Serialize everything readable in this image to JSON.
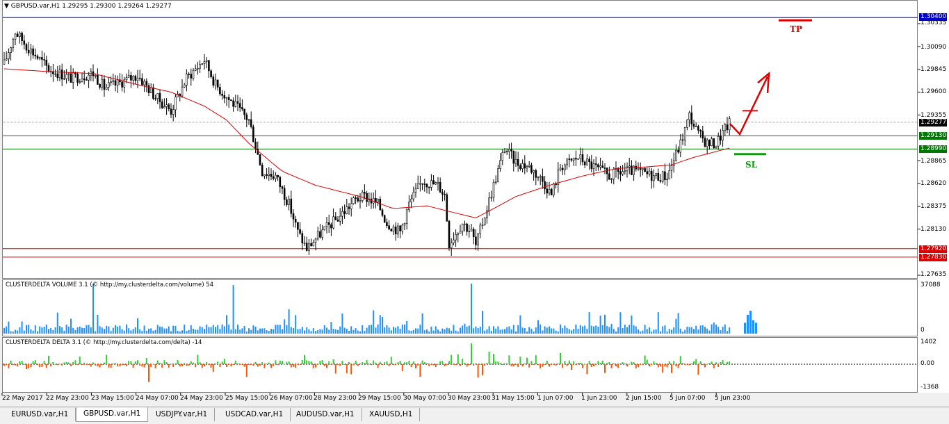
{
  "main": {
    "title": "GBPUSD.var,H1  1.29295 1.29300 1.29264 1.29277",
    "y_labels": [
      "1.30335",
      "1.30090",
      "1.29845",
      "1.29600",
      "1.29355",
      "1.28865",
      "1.28620",
      "1.28375",
      "1.28130",
      "1.27635"
    ],
    "levels": [
      {
        "value": "1.30400",
        "color": "#0000cc"
      },
      {
        "value": "1.29277",
        "color": "#000000"
      },
      {
        "value": "1.29130",
        "color": "#007700"
      },
      {
        "value": "1.28990",
        "color": "#007700"
      },
      {
        "value": "1.27920",
        "color": "#dd0000"
      },
      {
        "value": "1.27830",
        "color": "#dd0000"
      }
    ],
    "tp_label": "TP",
    "sl_label": "SL"
  },
  "volume": {
    "title": "CLUSTERDELTA VOLUME 3.1 (© http://my.clusterdelta.com/volume) 54",
    "max_label": "37088",
    "min_label": "0",
    "color": "#1e90ff"
  },
  "delta": {
    "title": "CLUSTERDELTA DELTA 3.1 (© http://my.clusterdelta.com/delta) -14",
    "max_label": "1402",
    "zero_label": "0.00",
    "min_label": "-1368",
    "pos_color": "#33cc33",
    "neg_color": "#ff5500"
  },
  "x_labels": [
    "22 May 2017",
    "22 May 23:00",
    "23 May 15:00",
    "24 May 07:00",
    "24 May 23:00",
    "25 May 15:00",
    "26 May 07:00",
    "28 May 23:00",
    "29 May 15:00",
    "30 May 07:00",
    "30 May 23:00",
    "31 May 15:00",
    "1 Jun 07:00",
    "1 Jun 23:00",
    "2 Jun 15:00",
    "5 Jun 07:00",
    "5 Jun 23:00"
  ],
  "tabs": [
    "EURUSD.var,H1",
    "GBPUSD.var,H1",
    "USDJPY.var,H1",
    "USDCAD.var,H1",
    "AUDUSD.var,H1",
    "XAUUSD,H1"
  ],
  "active_tab": "GBPUSD.var,H1",
  "chart_data": {
    "type": "candlestick",
    "symbol": "GBPUSD.var",
    "timeframe": "H1",
    "ylim": [
      1.2755,
      1.3046
    ],
    "sma_color": "#dd0000",
    "close_path": [
      [
        0,
        1.299
      ],
      [
        5,
        1.3025
      ],
      [
        10,
        1.301
      ],
      [
        20,
        1.2985
      ],
      [
        30,
        1.2975
      ],
      [
        40,
        1.298
      ],
      [
        45,
        1.2965
      ],
      [
        50,
        1.2968
      ],
      [
        60,
        1.2978
      ],
      [
        68,
        1.2955
      ],
      [
        75,
        1.294
      ],
      [
        82,
        1.2975
      ],
      [
        90,
        1.2995
      ],
      [
        95,
        1.2968
      ],
      [
        100,
        1.2955
      ],
      [
        110,
        1.293
      ],
      [
        116,
        1.2875
      ],
      [
        122,
        1.287
      ],
      [
        128,
        1.284
      ],
      [
        132,
        1.281
      ],
      [
        136,
        1.2792
      ],
      [
        142,
        1.2808
      ],
      [
        150,
        1.2825
      ],
      [
        158,
        1.2845
      ],
      [
        162,
        1.2848
      ],
      [
        168,
        1.284
      ],
      [
        172,
        1.282
      ],
      [
        178,
        1.281
      ],
      [
        182,
        1.284
      ],
      [
        188,
        1.2865
      ],
      [
        195,
        1.286
      ],
      [
        198,
        1.285
      ],
      [
        200,
        1.2798
      ],
      [
        206,
        1.282
      ],
      [
        210,
        1.281
      ],
      [
        212,
        1.2795
      ],
      [
        215,
        1.282
      ],
      [
        220,
        1.286
      ],
      [
        225,
        1.29
      ],
      [
        230,
        1.2885
      ],
      [
        236,
        1.288
      ],
      [
        242,
        1.2865
      ],
      [
        246,
        1.285
      ],
      [
        250,
        1.288
      ],
      [
        258,
        1.289
      ],
      [
        265,
        1.288
      ],
      [
        272,
        1.287
      ],
      [
        278,
        1.2875
      ],
      [
        284,
        1.2875
      ],
      [
        292,
        1.287
      ],
      [
        298,
        1.287
      ],
      [
        304,
        1.2905
      ],
      [
        308,
        1.2935
      ],
      [
        312,
        1.2915
      ],
      [
        316,
        1.2905
      ],
      [
        320,
        1.2905
      ],
      [
        324,
        1.292
      ],
      [
        326,
        1.2927
      ]
    ],
    "sma_path": [
      [
        0,
        1.2985
      ],
      [
        20,
        1.2982
      ],
      [
        40,
        1.298
      ],
      [
        60,
        1.2968
      ],
      [
        75,
        1.296
      ],
      [
        90,
        1.2945
      ],
      [
        100,
        1.293
      ],
      [
        110,
        1.2905
      ],
      [
        125,
        1.2875
      ],
      [
        140,
        1.286
      ],
      [
        160,
        1.2848
      ],
      [
        175,
        1.2835
      ],
      [
        190,
        1.2838
      ],
      [
        200,
        1.2832
      ],
      [
        212,
        1.2825
      ],
      [
        220,
        1.2835
      ],
      [
        230,
        1.2848
      ],
      [
        245,
        1.286
      ],
      [
        260,
        1.287
      ],
      [
        275,
        1.2878
      ],
      [
        290,
        1.288
      ],
      [
        300,
        1.2882
      ],
      [
        310,
        1.289
      ],
      [
        326,
        1.29
      ]
    ],
    "volume_max": 37088,
    "volume_spikes": [
      [
        40,
        37000
      ],
      [
        103,
        36000
      ],
      [
        210,
        37088
      ],
      [
        128,
        18000
      ],
      [
        188,
        15000
      ],
      [
        240,
        10000
      ],
      [
        270,
        14000
      ],
      [
        302,
        11000
      ]
    ],
    "volume_pending": [
      8000,
      14000,
      17000,
      10000,
      8000
    ],
    "delta_range": [
      -1368,
      1402
    ],
    "delta_spikes": [
      [
        65,
        -1200
      ],
      [
        109,
        -850
      ],
      [
        210,
        1402
      ],
      [
        213,
        -900
      ],
      [
        215,
        -750
      ],
      [
        187,
        -850
      ],
      [
        218,
        850
      ],
      [
        250,
        750
      ],
      [
        312,
        -700
      ]
    ]
  }
}
